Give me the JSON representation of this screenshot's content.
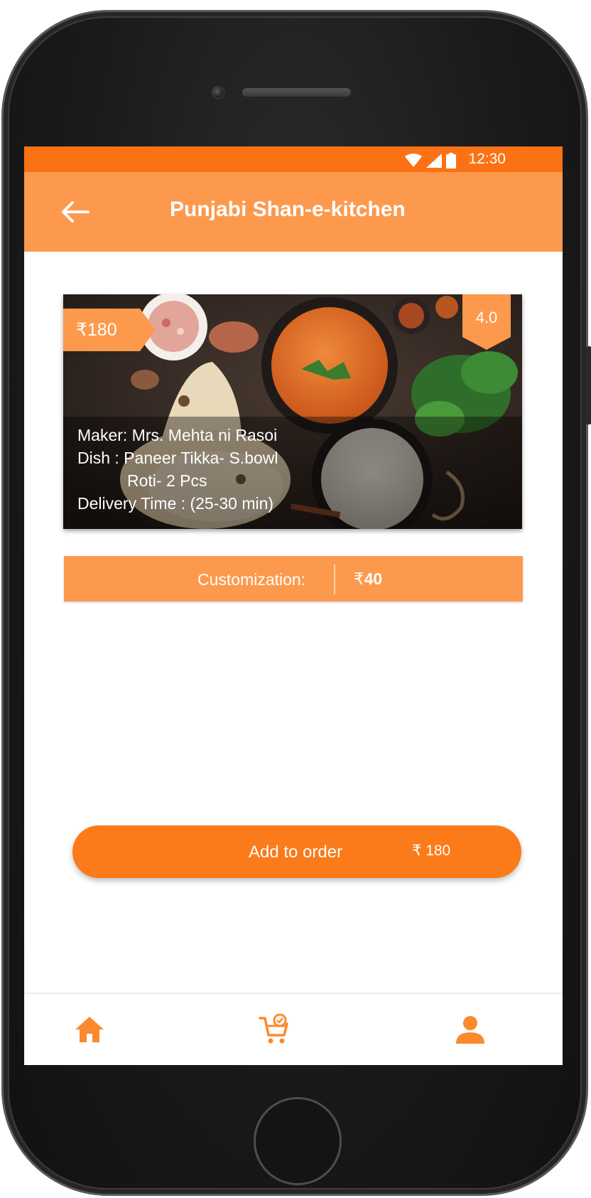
{
  "status_bar": {
    "time": "12:30"
  },
  "header": {
    "title": "Punjabi Shan-e-kitchen"
  },
  "food_card": {
    "price": "₹180",
    "rating": "4.0",
    "maker": "Maker: Mrs. Mehta ni Rasoi",
    "dish_line1": "Dish : Paneer Tikka- S.bowl",
    "dish_line2": "Roti- 2 Pcs",
    "delivery": "Delivery Time : (25-30 min)"
  },
  "customization": {
    "label": "Customization:",
    "currency": "₹",
    "amount": "40"
  },
  "order_button": {
    "label": "Add to order",
    "price": "₹ 180"
  },
  "bottom_nav": {
    "items": [
      {
        "icon": "home-icon"
      },
      {
        "icon": "cart-check-icon"
      },
      {
        "icon": "user-icon"
      }
    ]
  },
  "colors": {
    "status_bar": "#fb7215",
    "accent": "#fd994d",
    "button": "#fb7a1a"
  }
}
